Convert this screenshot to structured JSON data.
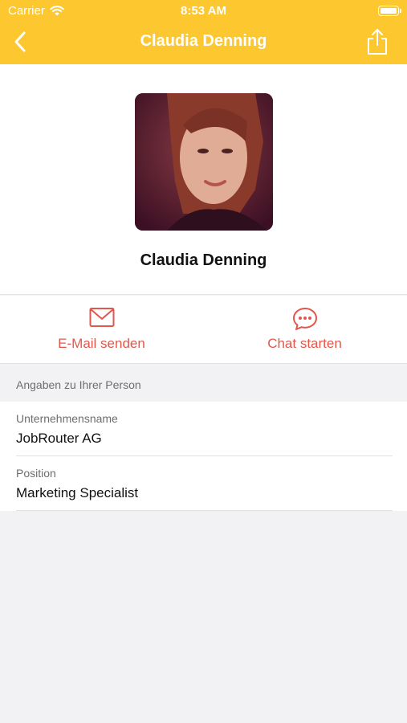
{
  "status_bar": {
    "carrier": "Carrier",
    "time": "8:53 AM"
  },
  "nav": {
    "title": "Claudia Denning",
    "back_icon": "chevron-left-icon",
    "share_icon": "share-icon"
  },
  "profile": {
    "name": "Claudia Denning"
  },
  "actions": {
    "email_label": "E-Mail senden",
    "chat_label": "Chat starten"
  },
  "section": {
    "title": "Angaben zu Ihrer Person"
  },
  "fields": [
    {
      "label": "Unternehmensname",
      "value": "JobRouter AG"
    },
    {
      "label": "Position",
      "value": "Marketing Specialist"
    }
  ],
  "colors": {
    "header": "#fdc72f",
    "accent": "#e2574c"
  }
}
